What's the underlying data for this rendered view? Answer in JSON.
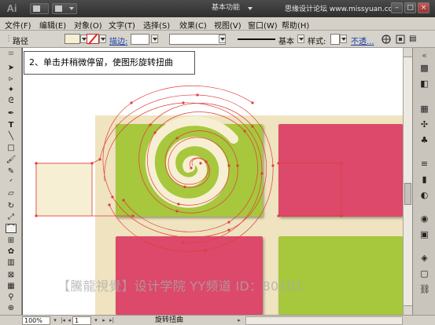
{
  "app": {
    "logo": "Ai",
    "workspace": "基本功能"
  },
  "watermark_top": "思缘设计论坛 www.missyuan.com",
  "window_controls": [
    "–",
    "□",
    "×"
  ],
  "menu": [
    "文件(F)",
    "编辑(E)",
    "对象(O)",
    "文字(T)",
    "选择(S)",
    "效果(C)",
    "视图(V)",
    "窗口(W)",
    "帮助(H)"
  ],
  "control_bar": {
    "object_type": "路径",
    "stroke_link": "描边:",
    "brush_label": "基本",
    "style_label": "样式:",
    "opacity_link": "不透...",
    "graphic_link": "›"
  },
  "canvas": {
    "hint": "2、单击并稍微停留，使图形旋转扭曲",
    "watermark": "【騰龍視覺】设计学院  YY频道 ID：80101"
  },
  "status": {
    "zoom": "100%",
    "page": "1",
    "tool_name": "旋转扭曲"
  },
  "colors": {
    "artboard_bg": "#efe4bf",
    "green_tile": "#a7c73e",
    "pink_tile": "#dc4a6a",
    "cream": "#f7efd3",
    "path_red": "#e23c3c"
  },
  "tools": [
    "selection-icon",
    "direct-selection-icon",
    "magic-wand-icon",
    "lasso-icon",
    "pen-icon",
    "type-icon",
    "line-icon",
    "rectangle-icon",
    "paintbrush-icon",
    "pencil-icon",
    "blob-brush-icon",
    "eraser-icon",
    "rotate-icon",
    "scale-icon",
    "warp-icon",
    "free-transform-icon",
    "symbol-sprayer-icon",
    "graph-icon",
    "mesh-icon",
    "gradient-icon",
    "eyedropper-icon",
    "blend-icon",
    "live-paint-icon",
    "artboard-icon",
    "slice-icon",
    "hand-icon",
    "zoom-icon"
  ]
}
